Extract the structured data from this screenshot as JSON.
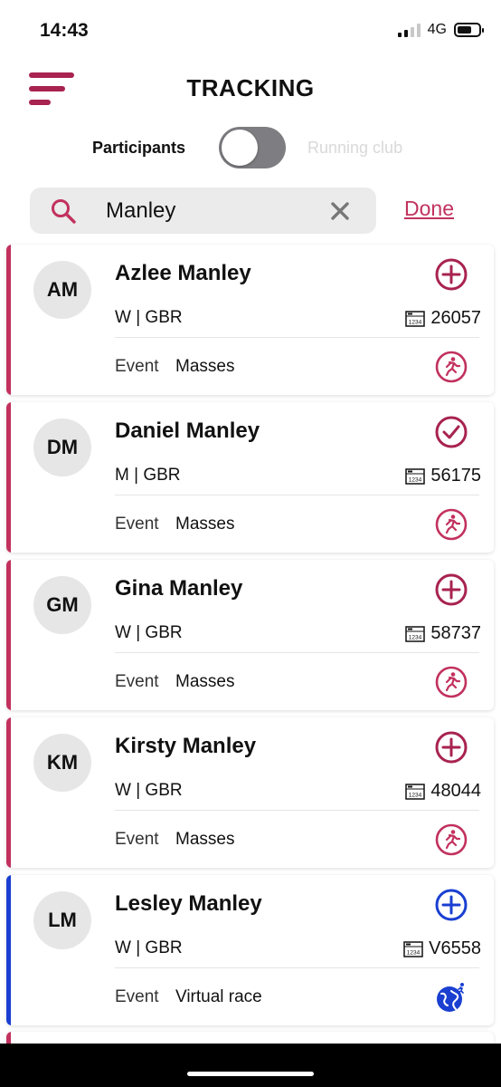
{
  "status_bar": {
    "time": "14:43",
    "network": "4G"
  },
  "header": {
    "title": "TRACKING"
  },
  "toggle": {
    "left_label": "Participants",
    "right_label": "Running club"
  },
  "search": {
    "value": "Manley",
    "done_label": "Done"
  },
  "colors": {
    "brand": "#c2315e",
    "brand_dark": "#a8234f",
    "virtual": "#1a3fd1"
  },
  "participants": [
    {
      "initials": "AM",
      "name": "Azlee Manley",
      "meta": "W | GBR",
      "bib": "26057",
      "event_label": "Event",
      "event": "Masses",
      "action_icon": "add-circle-icon",
      "event_icon": "runner-icon",
      "accent": "#c2315e"
    },
    {
      "initials": "DM",
      "name": "Daniel Manley",
      "meta": "M | GBR",
      "bib": "56175",
      "event_label": "Event",
      "event": "Masses",
      "action_icon": "check-circle-icon",
      "event_icon": "runner-icon",
      "accent": "#c2315e"
    },
    {
      "initials": "GM",
      "name": "Gina Manley",
      "meta": "W | GBR",
      "bib": "58737",
      "event_label": "Event",
      "event": "Masses",
      "action_icon": "add-circle-icon",
      "event_icon": "runner-icon",
      "accent": "#c2315e"
    },
    {
      "initials": "KM",
      "name": "Kirsty Manley",
      "meta": "W | GBR",
      "bib": "48044",
      "event_label": "Event",
      "event": "Masses",
      "action_icon": "add-circle-icon",
      "event_icon": "runner-icon",
      "accent": "#c2315e"
    },
    {
      "initials": "LM",
      "name": "Lesley Manley",
      "meta": "W | GBR",
      "bib": "V6558",
      "event_label": "Event",
      "event": "Virtual race",
      "action_icon": "add-circle-icon",
      "event_icon": "globe-runner-icon",
      "accent": "#1a3fd1"
    }
  ]
}
